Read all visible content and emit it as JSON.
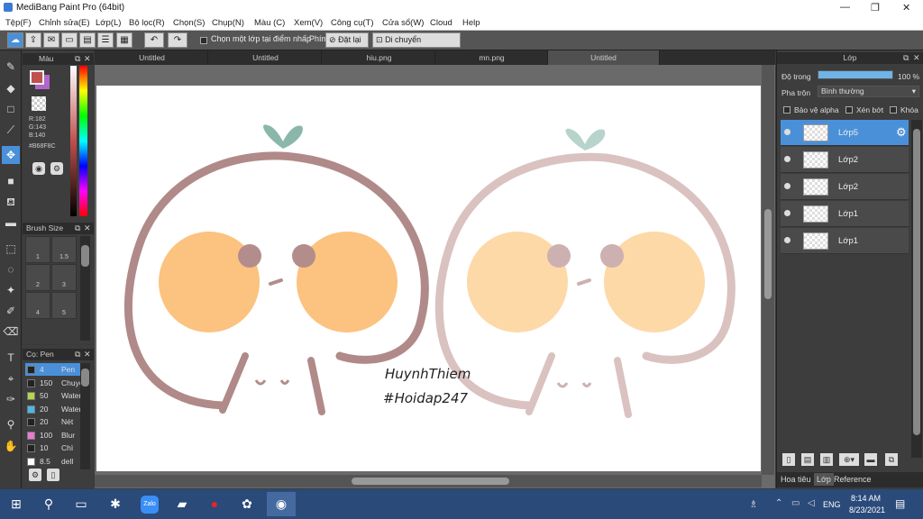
{
  "window": {
    "title": "MediBang Paint Pro (64bit)",
    "minimize": "—",
    "maximize": "❐",
    "close": "✕"
  },
  "menu": [
    "Tệp(F)",
    "Chỉnh sửa(E)",
    "Lớp(L)",
    "Bộ lọc(R)",
    "Chọn(S)",
    "Chụp(N)",
    "Màu (C)",
    "Xem(V)",
    "Công cụ(T)",
    "Cửa sổ(W)",
    "Cloud",
    "Help"
  ],
  "toolbar": {
    "select_ref_label": "Chọn một lớp tại điểm nhấp",
    "phim_label": "Phím",
    "reset_label": "Đặt lại",
    "move_label": "Di chuyển ngang/doc"
  },
  "tabs": [
    "Untitled",
    "Untitled",
    "hiu.png",
    "mn.png",
    "Untitled"
  ],
  "color_panel": {
    "title": "Màu",
    "r": "R:182",
    "g": "G:143",
    "b": "B:140",
    "hex": "#B68F8C",
    "main_color": "#c0504d",
    "sub_color": "#b266c9"
  },
  "brush_size": {
    "title": "Brush Size",
    "cells": [
      "1",
      "1.5",
      "2",
      "3",
      "4",
      "5"
    ]
  },
  "pens": {
    "title": "Cọ: Pen",
    "items": [
      {
        "size": "4",
        "name": "Pen",
        "color": "#222222"
      },
      {
        "size": "150",
        "name": "Chuyển",
        "color": "#222222"
      },
      {
        "size": "50",
        "name": "Water",
        "color": "#b5d64a"
      },
      {
        "size": "20",
        "name": "Water",
        "color": "#4ab9e8"
      },
      {
        "size": "20",
        "name": "Nét",
        "color": "#222222"
      },
      {
        "size": "100",
        "name": "Blur",
        "color": "#e87ad4"
      },
      {
        "size": "10",
        "name": "Chì",
        "color": "#222222"
      },
      {
        "size": "8.5",
        "name": "dell",
        "color": "#ffffff"
      }
    ]
  },
  "right_panel": {
    "title": "Lớp",
    "opacity_label": "Độ trong",
    "opacity_value": "100 %",
    "opacity": 1.0,
    "blend_label": "Pha trộn",
    "blend_value": "Bình thường",
    "protect_alpha": "Bảo vệ alpha",
    "clipping": "Xén bớt",
    "lock": "Khóa",
    "layers": [
      "Lớp5",
      "Lớp2",
      "Lớp2",
      "Lớp1",
      "Lớp1"
    ],
    "bottom_tabs": [
      "Hoa tiêu",
      "Lớp",
      "Reference"
    ]
  },
  "canvas": {
    "text1": "HuynhThiem",
    "text2": "#Hoidap247",
    "outline_dark": "#b08a88",
    "outline_light": "#d9c2c0",
    "cheek_dark": "#fcc27f",
    "cheek_light": "#fdd9a8",
    "sprout": "#8ab7aa"
  },
  "taskbar": {
    "time": "8:14 AM",
    "date": "8/23/2021",
    "lang": "ENG",
    "icons": [
      "windows-icon",
      "search-icon",
      "task-view-icon",
      "store-icon",
      "zalo-icon",
      "files-icon",
      "opera-icon",
      "paint-icon",
      "medibang-icon"
    ]
  }
}
